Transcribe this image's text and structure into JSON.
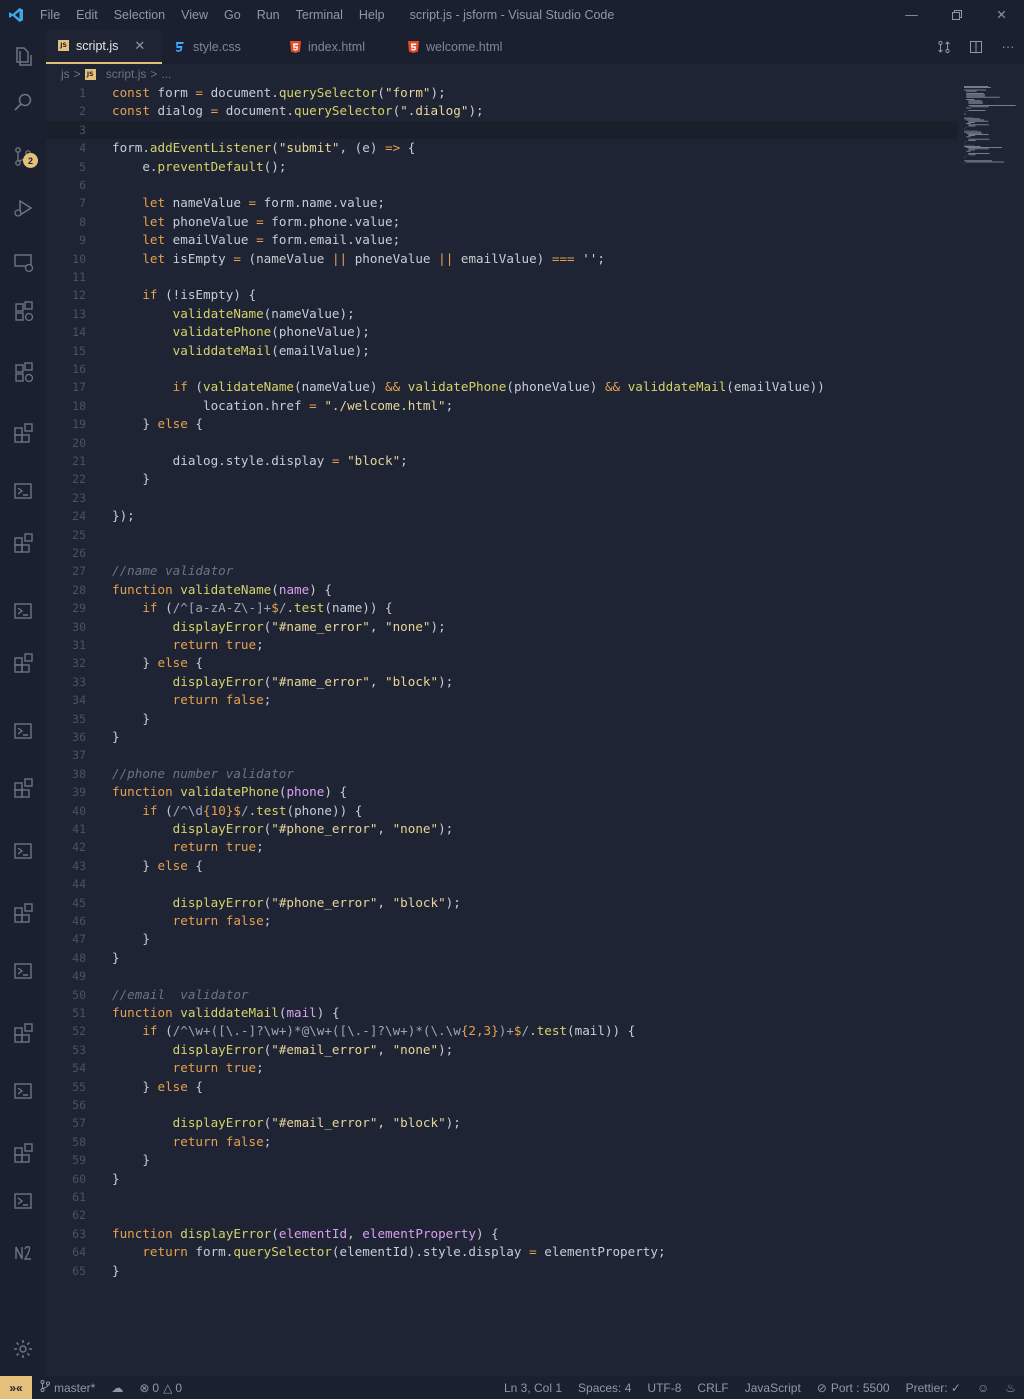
{
  "window": {
    "title": "script.js - jsform - Visual Studio Code",
    "menu": [
      "File",
      "Edit",
      "Selection",
      "View",
      "Go",
      "Run",
      "Terminal",
      "Help"
    ]
  },
  "activity_bar": {
    "source_control_badge": "2",
    "icons": [
      "explorer-icon",
      "search-icon",
      "source-control-icon",
      "run-debug-icon",
      "remote-explorer-icon",
      "extension-icon",
      "extension-icon",
      "extensions-icon",
      "terminal-icon",
      "extensions-icon",
      "terminal-icon",
      "extensions-icon",
      "terminal-icon",
      "extensions-icon",
      "terminal-icon",
      "extensions-icon",
      "terminal-icon",
      "extensions-icon",
      "terminal-icon",
      "extensions-icon",
      "terminal-icon",
      "notes-icon",
      "settings-icon"
    ]
  },
  "tabs": [
    {
      "label": "script.js",
      "icon": "js-file-icon",
      "active": true
    },
    {
      "label": "style.css",
      "icon": "css-file-icon",
      "active": false
    },
    {
      "label": "index.html",
      "icon": "html-file-icon",
      "active": false
    },
    {
      "label": "welcome.html",
      "icon": "html-file-icon",
      "active": false
    }
  ],
  "breadcrumb": [
    "js",
    ">",
    "script.js",
    ">",
    "..."
  ],
  "editor": {
    "cursor_line": 3,
    "lines": [
      "const form = document.querySelector(\"form\");",
      "const dialog = document.querySelector(\".dialog\");",
      "",
      "form.addEventListener(\"submit\", (e) => {",
      "    e.preventDefault();",
      "",
      "    let nameValue = form.name.value;",
      "    let phoneValue = form.phone.value;",
      "    let emailValue = form.email.value;",
      "    let isEmpty = (nameValue || phoneValue || emailValue) === '';",
      "",
      "    if (!isEmpty) {",
      "        validateName(nameValue);",
      "        validatePhone(phoneValue);",
      "        validdateMail(emailValue);",
      "",
      "        if (validateName(nameValue) && validatePhone(phoneValue) && validdateMail(emailValue))",
      "            location.href = \"./welcome.html\";",
      "    } else {",
      "",
      "        dialog.style.display = \"block\";",
      "    }",
      "",
      "});",
      "",
      "",
      "//name validator",
      "function validateName(name) {",
      "    if (/^[a-zA-Z\\-]+$/.test(name)) {",
      "        displayError(\"#name_error\", \"none\");",
      "        return true;",
      "    } else {",
      "        displayError(\"#name_error\", \"block\");",
      "        return false;",
      "    }",
      "}",
      "",
      "//phone number validator",
      "function validatePhone(phone) {",
      "    if (/^\\d{10}$/.test(phone)) {",
      "        displayError(\"#phone_error\", \"none\");",
      "        return true;",
      "    } else {",
      "",
      "        displayError(\"#phone_error\", \"block\");",
      "        return false;",
      "    }",
      "}",
      "",
      "//email  validator",
      "function validdateMail(mail) {",
      "    if (/^\\w+([\\.-]?\\w+)*@\\w+([\\.-]?\\w+)*(\\.\\w{2,3})+$/.test(mail)) {",
      "        displayError(\"#email_error\", \"none\");",
      "        return true;",
      "    } else {",
      "",
      "        displayError(\"#email_error\", \"block\");",
      "        return false;",
      "    }",
      "}",
      "",
      "",
      "function displayError(elementId, elementProperty) {",
      "    return form.querySelector(elementId).style.display = elementProperty;",
      "}"
    ]
  },
  "status_bar": {
    "branch": "master*",
    "errors": "0",
    "warnings": "0",
    "position": "Ln 3, Col 1",
    "spaces": "Spaces: 4",
    "encoding": "UTF-8",
    "eol": "CRLF",
    "language": "JavaScript",
    "port": "Port : 5500",
    "prettier": "Prettier: ✓"
  },
  "colors": {
    "background": "#1e2433",
    "chrome": "#1b2030",
    "accent": "#e5c07b",
    "keyword": "#e8a04e",
    "function": "#d6d26b",
    "string": "#e8d59a",
    "comment": "#6b7384"
  }
}
